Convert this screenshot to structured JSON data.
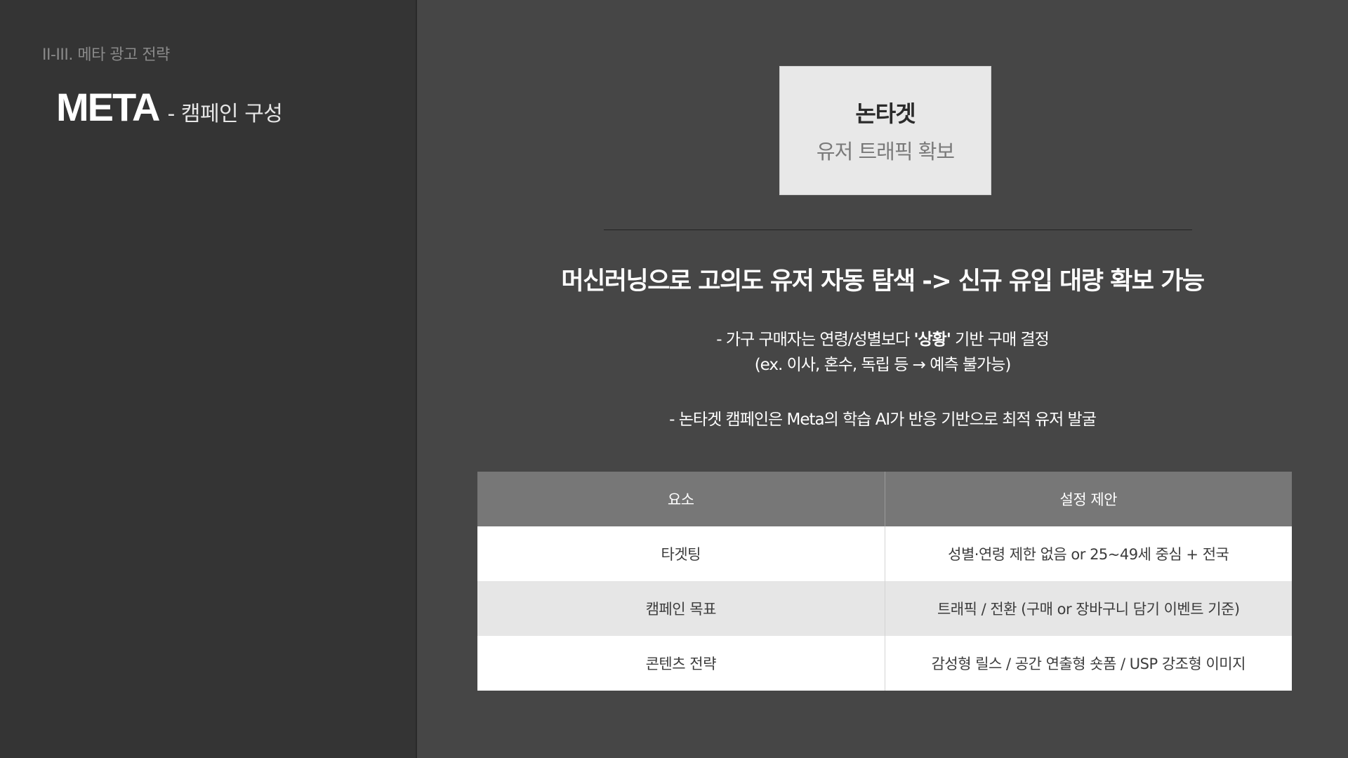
{
  "section_label": "II-III. 메타 광고 전략",
  "heading": {
    "main": "META",
    "sub": "- 캠페인 구성"
  },
  "box": {
    "title": "논타겟",
    "subtitle": "유저 트래픽 확보"
  },
  "headline": "머신러닝으로 고의도 유저 자동 탐색 -> 신규 유입 대량 확보 가능",
  "bullets": {
    "line1_pre": "- 가구 구매자는 연령/성별보다 ",
    "line1_bold": "'상황'",
    "line1_post": " 기반 구매 결정",
    "line2": "(ex. 이사, 혼수, 독립 등 → 예측 불가능)",
    "line3": "- 논타겟 캠페인은 Meta의 학습 AI가 반응 기반으로 최적 유저 발굴"
  },
  "table": {
    "headers": [
      "요소",
      "설정 제안"
    ],
    "rows": [
      [
        "타겟팅",
        "성별·연령 제한 없음 or 25~49세 중심 + 전국"
      ],
      [
        "캠페인 목표",
        "트래픽 / 전환 (구매 or 장바구니 담기 이벤트 기준)"
      ],
      [
        "콘텐츠 전략",
        "감성형 릴스 / 공간 연출형 숏폼 / USP 강조형 이미지"
      ]
    ]
  }
}
